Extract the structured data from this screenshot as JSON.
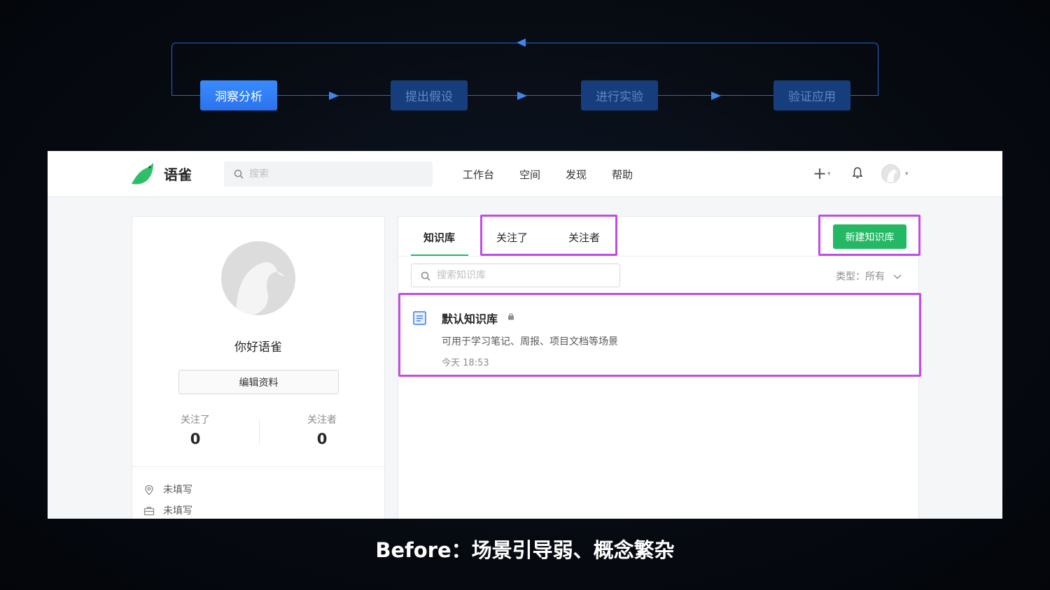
{
  "flow": {
    "steps": [
      "洞察分析",
      "提出假设",
      "进行实验",
      "验证应用"
    ],
    "colors": {
      "active": "#2f7df5",
      "inactive": "#173e7c",
      "line": "#2b63c9"
    }
  },
  "app": {
    "logo_text": "语雀",
    "search_placeholder": "搜索",
    "nav": [
      "工作台",
      "空间",
      "发现",
      "帮助"
    ],
    "icons": {
      "add": "plus-icon",
      "notifications": "bell-icon",
      "user": "avatar"
    }
  },
  "profile": {
    "name": "你好语雀",
    "edit_label": "编辑资料",
    "following_label": "关注了",
    "following_count": "0",
    "followers_label": "关注者",
    "followers_count": "0",
    "location": "未填写",
    "company": "未填写"
  },
  "panel": {
    "tabs": [
      "知识库",
      "关注了",
      "关注者"
    ],
    "active_tab": "知识库",
    "new_button": "新建知识库",
    "search_placeholder": "搜索知识库",
    "type_filter": "类型：所有",
    "repo": {
      "title": "默认知识库",
      "description": "可用于学习笔记、周报、项目文档等场景",
      "time": "今天 18:53"
    }
  },
  "colors": {
    "brand_green": "#25b864",
    "highlight": "#c04de8"
  },
  "caption": "Before：场景引导弱、概念繁杂"
}
